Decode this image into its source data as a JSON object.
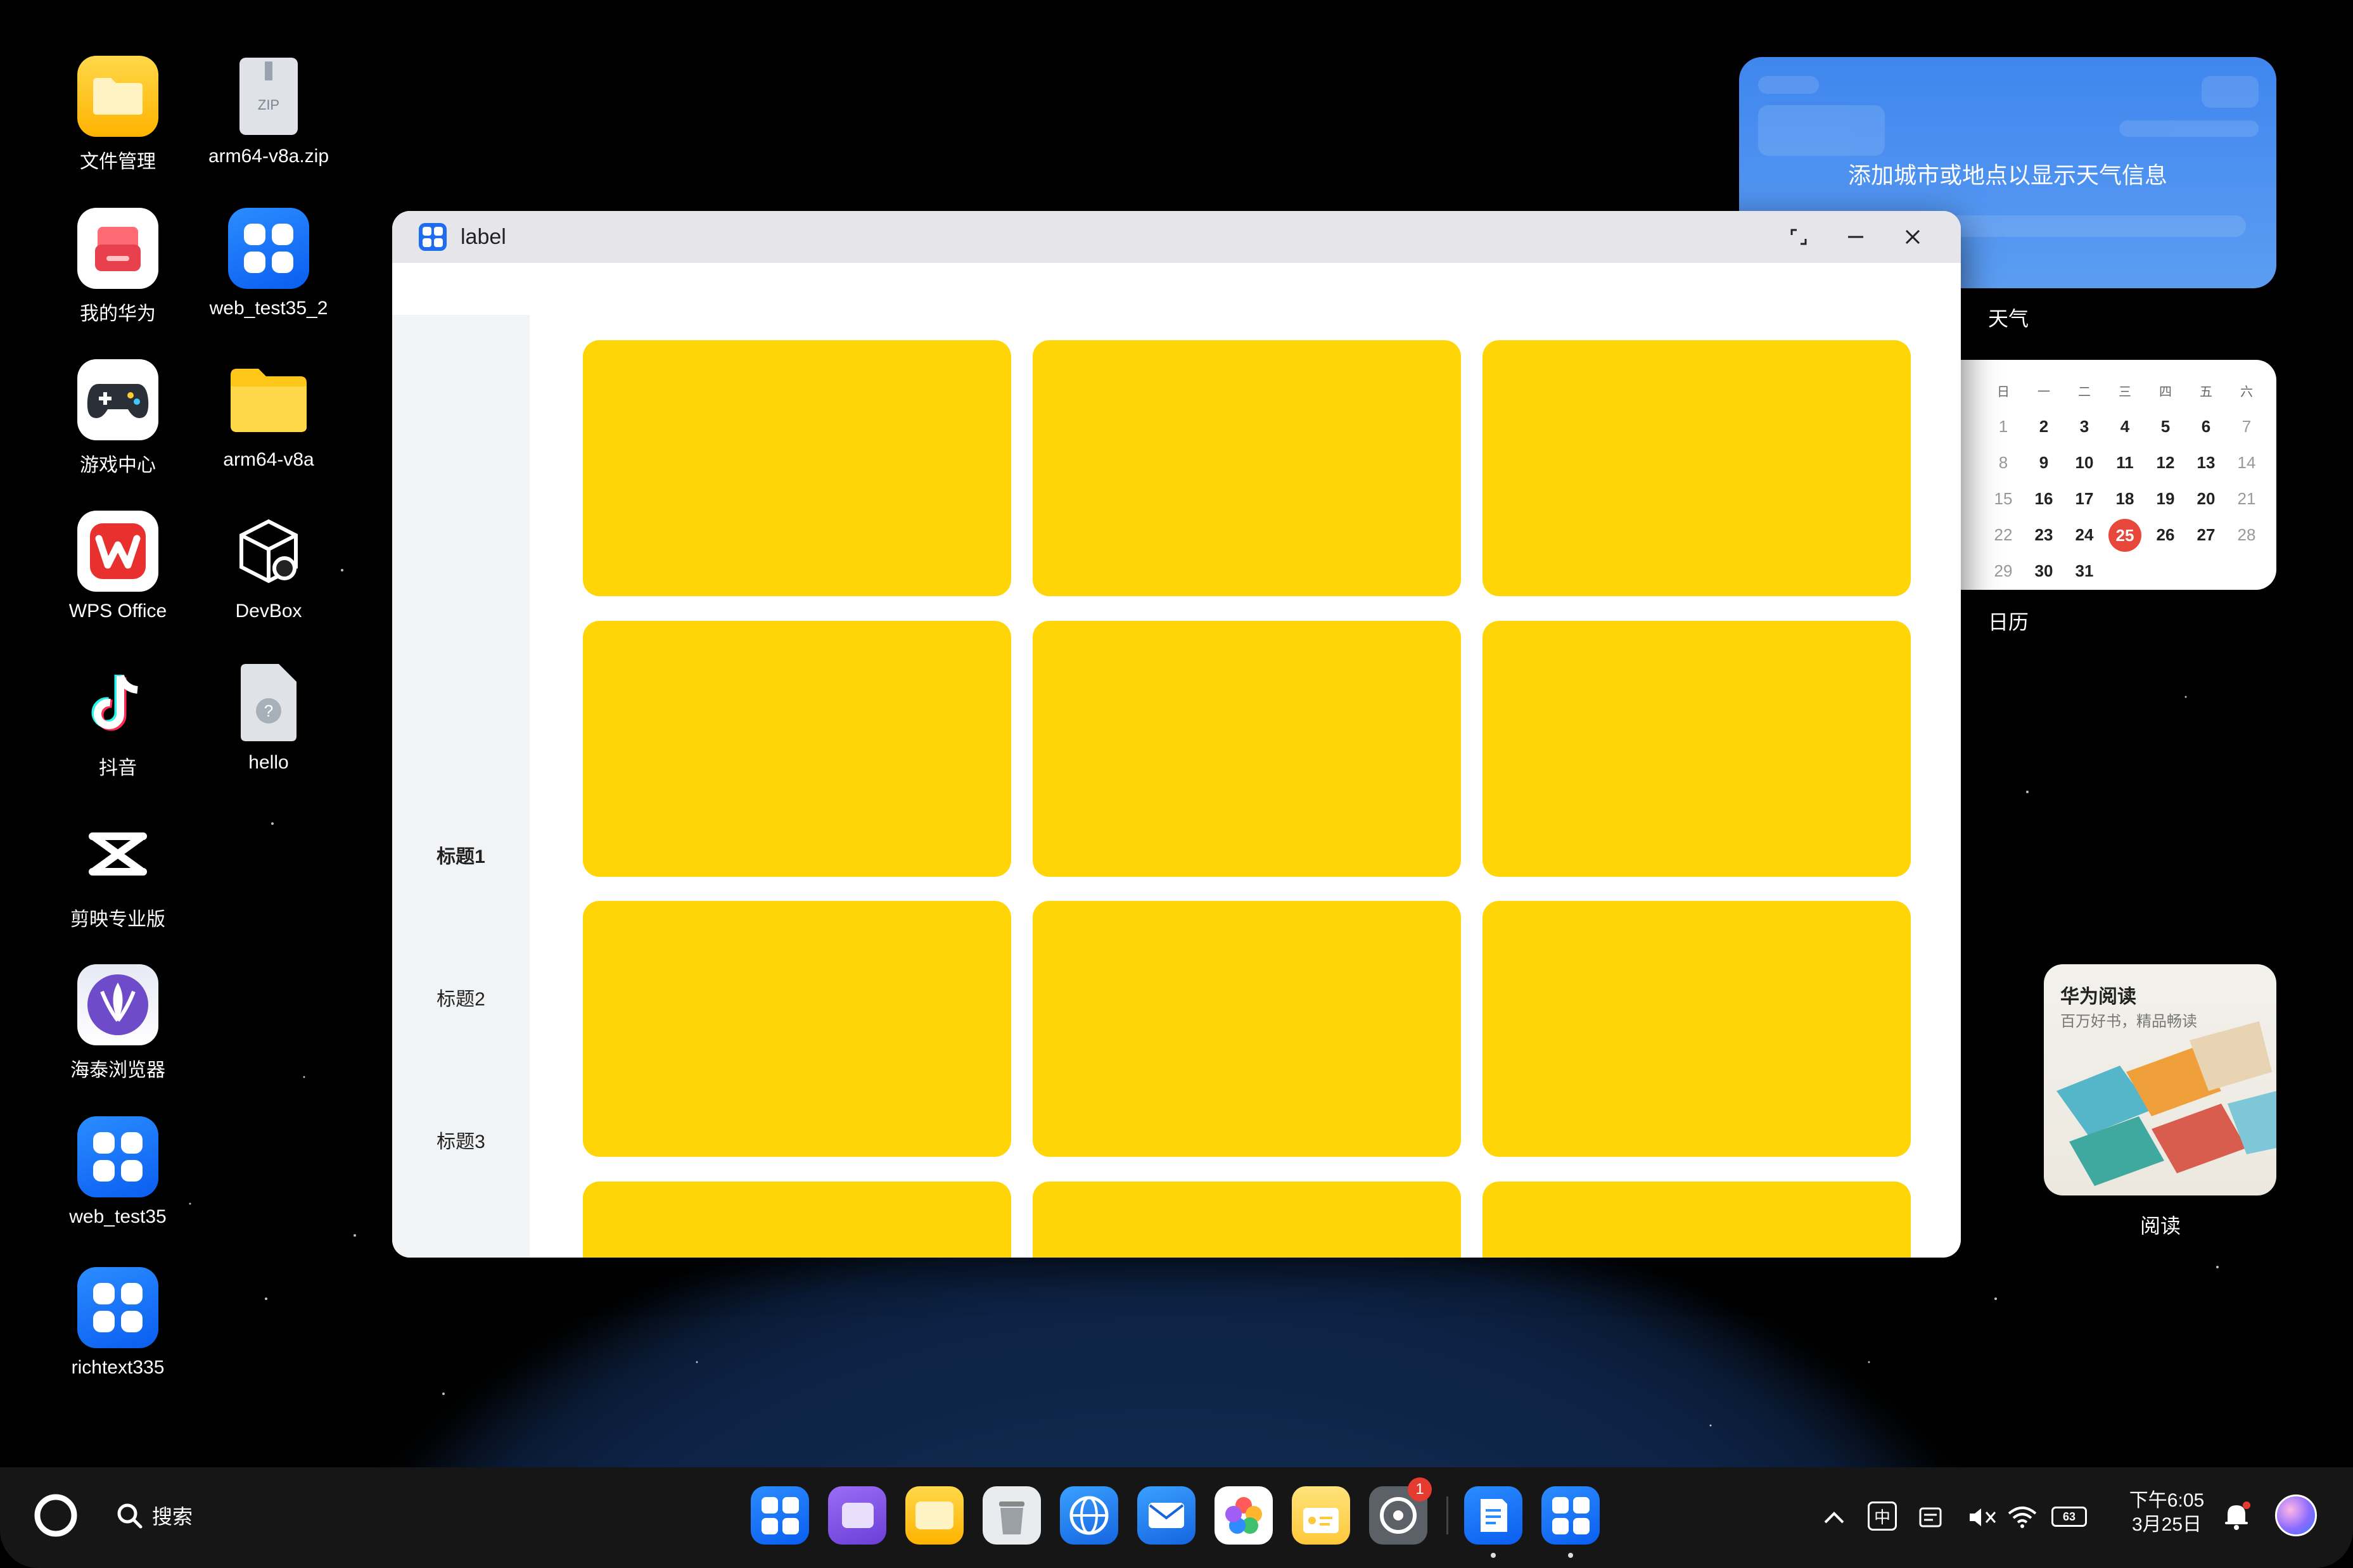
{
  "desktop": {
    "icons": [
      {
        "label": "文件管理"
      },
      {
        "label": "arm64-v8a.zip",
        "badge": "ZIP"
      },
      {
        "label": "我的华为"
      },
      {
        "label": "web_test35_2"
      },
      {
        "label": "游戏中心"
      },
      {
        "label": "arm64-v8a"
      },
      {
        "label": "WPS Office"
      },
      {
        "label": "DevBox"
      },
      {
        "label": "抖音"
      },
      {
        "label": "hello"
      },
      {
        "label": "剪映专业版"
      },
      {
        "label": "海泰浏览器"
      },
      {
        "label": "web_test35"
      },
      {
        "label": "richtext335"
      }
    ]
  },
  "widgets": {
    "weather": {
      "message": "添加城市或地点以显示天气信息",
      "label": "天气"
    },
    "calendar": {
      "label": "日历",
      "weekdays": [
        "日",
        "一",
        "二",
        "三",
        "四",
        "五",
        "六"
      ],
      "days": [
        "1",
        "2",
        "3",
        "4",
        "5",
        "6",
        "7",
        "8",
        "9",
        "10",
        "11",
        "12",
        "13",
        "14",
        "15",
        "16",
        "17",
        "18",
        "19",
        "20",
        "21",
        "22",
        "23",
        "24",
        "25",
        "26",
        "27",
        "28",
        "29",
        "30",
        "31"
      ],
      "today": "25"
    },
    "reading": {
      "title": "华为阅读",
      "subtitle": "百万好书，精品畅读",
      "label": "阅读"
    }
  },
  "window": {
    "title": "label",
    "tabs": [
      "标题1",
      "标题2",
      "标题3"
    ],
    "active_tab": 0,
    "card_color": "#ffd508"
  },
  "taskbar": {
    "search_label": "搜索",
    "settings_badge": "1",
    "ime": "中",
    "battery": "63",
    "time": "下午6:05",
    "date": "3月25日"
  }
}
